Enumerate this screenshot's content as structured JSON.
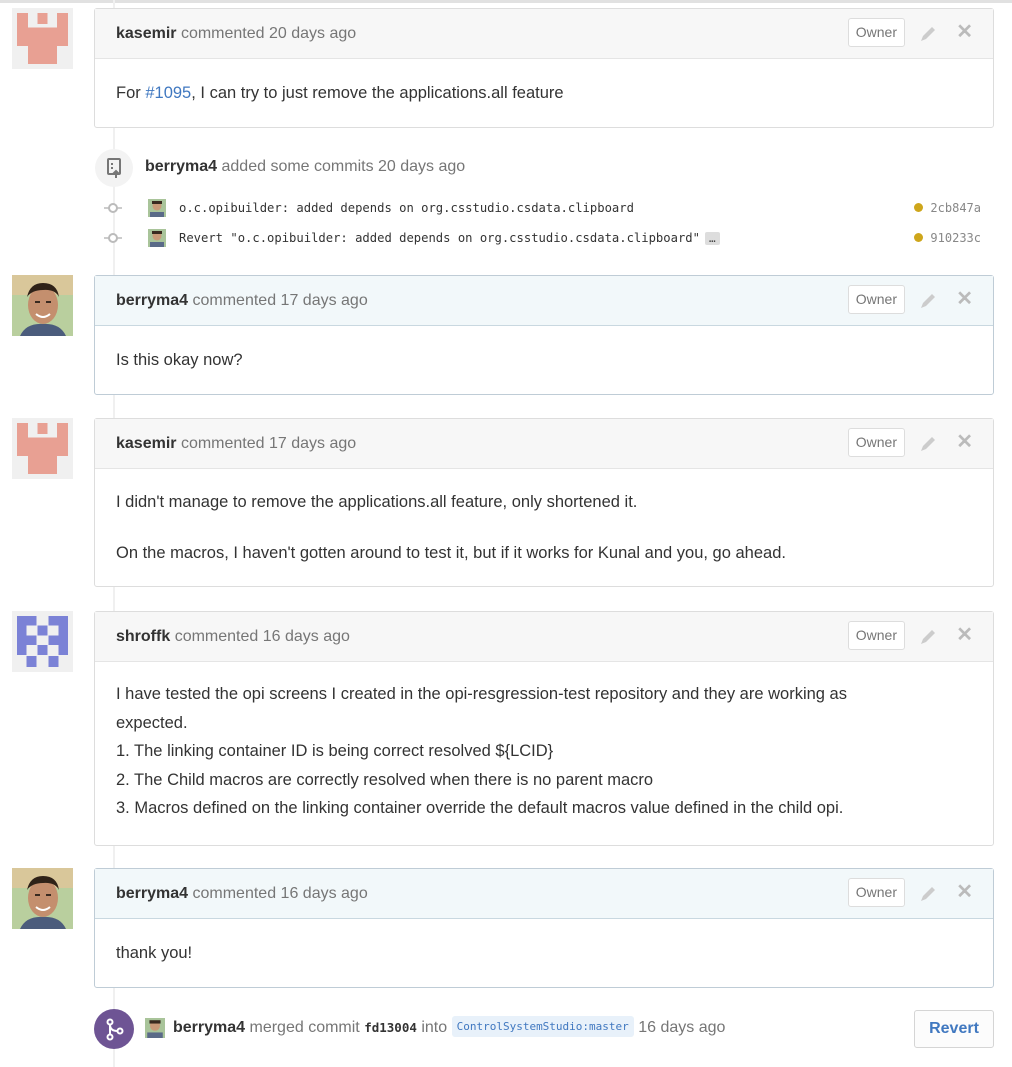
{
  "comments": [
    {
      "author": "kasemir",
      "action": "commented",
      "time": "20 days ago",
      "badge": "Owner",
      "prefix": "For ",
      "link": "#1095",
      "suffix": ", I can try to just remove the applications.all feature"
    },
    {
      "author": "berryma4",
      "action": "commented",
      "time": "17 days ago",
      "badge": "Owner",
      "paragraphs": [
        "Is this okay now?"
      ]
    },
    {
      "author": "kasemir",
      "action": "commented",
      "time": "17 days ago",
      "badge": "Owner",
      "paragraphs": [
        "I didn't manage to remove the applications.all feature, only shortened it.",
        "On the macros, I haven't gotten around to test it, but if it works for Kunal and you, go ahead."
      ]
    },
    {
      "author": "shroffk",
      "action": "commented",
      "time": "16 days ago",
      "badge": "Owner",
      "lines": [
        "I have tested the opi screens I created in the opi-resgression-test repository and they are working as",
        "expected.",
        "1. The linking container ID is being correct resolved ${LCID}",
        "2. The Child macros are correctly resolved when there is no parent macro",
        "3. Macros defined on the linking container override the default macros value defined in the child opi."
      ]
    },
    {
      "author": "berryma4",
      "action": "commented",
      "time": "16 days ago",
      "badge": "Owner",
      "paragraphs": [
        "thank you!"
      ]
    }
  ],
  "commit_event": {
    "author": "berryma4",
    "action": "added some commits",
    "time": "20 days ago",
    "commits": [
      {
        "message": "o.c.opibuilder: added depends on org.csstudio.csdata.clipboard",
        "sha": "2cb847a",
        "more": ""
      },
      {
        "message": "Revert \"o.c.opibuilder: added depends on org.csstudio.csdata.clipboard\"",
        "sha": "910233c",
        "more": "…"
      }
    ]
  },
  "merge_event": {
    "author": "berryma4",
    "action": "merged commit",
    "sha": "fd13004",
    "into": "into",
    "ref": "ControlSystemStudio:master",
    "time": "16 days ago",
    "revert_label": "Revert"
  },
  "colors": {
    "link": "#4078c0",
    "merge": "#6e5494",
    "sha_dot": "#cea61b",
    "identicon_kasemir": "#e8a093",
    "identicon_shroffk": "#7b82d6"
  },
  "icons": [
    "pencil-icon",
    "close-icon",
    "repo-push-icon",
    "commit-dot-icon",
    "git-merge-icon"
  ]
}
